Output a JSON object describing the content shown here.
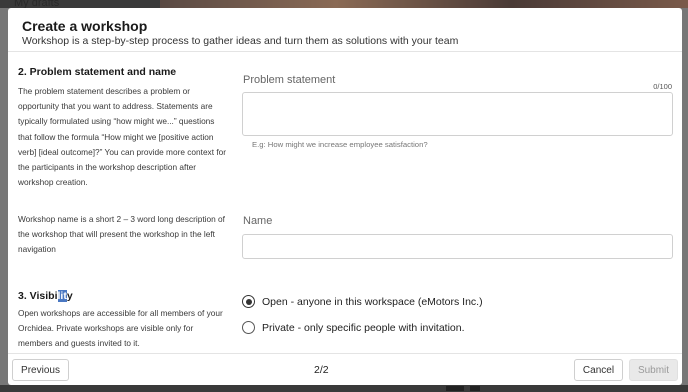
{
  "background": {
    "sidebar_item": "My drafts"
  },
  "modal": {
    "title": "Create a workshop",
    "subtitle": "Workshop is a step-by-step process to gather ideas and turn them as solutions with your team"
  },
  "problem_section": {
    "title": "2. Problem statement and name",
    "description": "The problem statement describes a problem or opportunity that you want to address. Statements are typically formulated using “how might we...” questions that follow the formula “How might we [positive action verb] [ideal outcome]?” You can provide more context for the participants in the workshop description after workshop creation.",
    "name_description": "Workshop name is a short 2 – 3 word long description of the workshop that will present the workshop in the left navigation"
  },
  "problem_field": {
    "label": "Problem statement",
    "counter": "0/100",
    "value": "",
    "hint": "E.g: How might we increase employee satisfaction?"
  },
  "name_field": {
    "label": "Name",
    "value": ""
  },
  "visibility_section": {
    "title_before": "3. Visibi",
    "title_selected": "lit",
    "title_after": "y",
    "description": "Open workshops are accessible for all members of your Orchidea. Private workshops are visible only for members and guests invited to it."
  },
  "visibility_options": [
    {
      "label": "Open - anyone in this workspace (eMotors Inc.)",
      "selected": true
    },
    {
      "label": "Private - only specific people with invitation.",
      "selected": false
    }
  ],
  "footer": {
    "previous_label": "Previous",
    "page_indicator": "2/2",
    "cancel_label": "Cancel",
    "submit_label": "Submit"
  }
}
